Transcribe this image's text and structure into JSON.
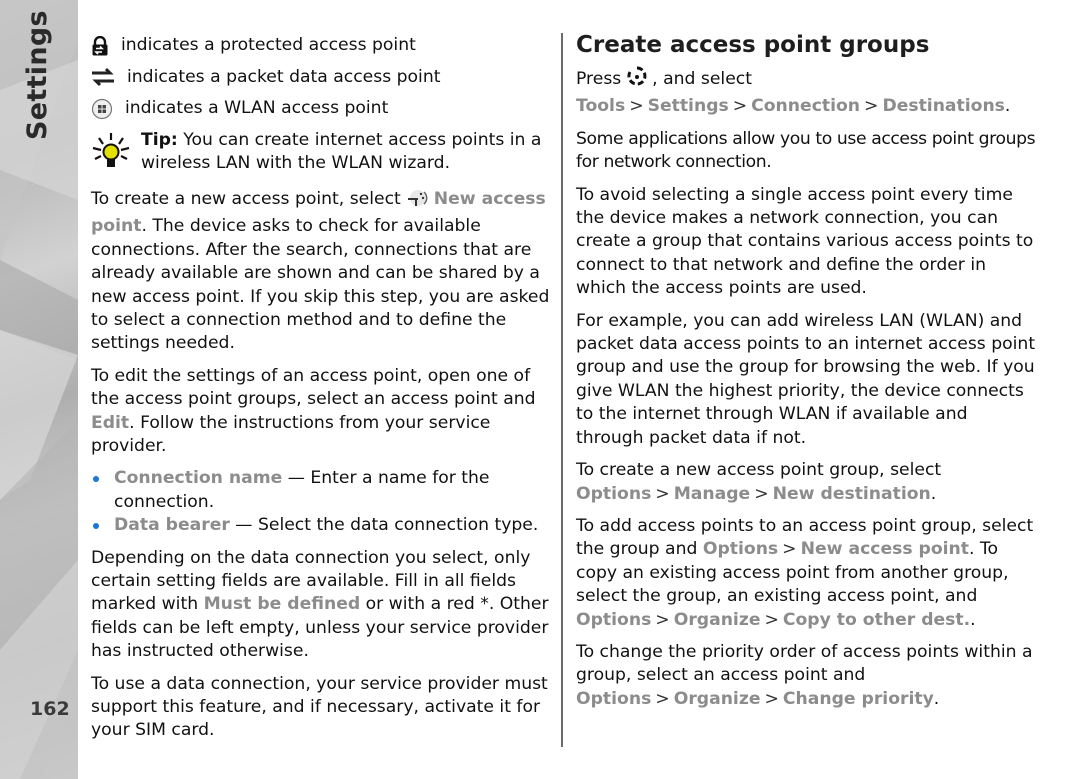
{
  "sidebar": {
    "section_title": "Settings",
    "page_number": "162"
  },
  "left_column": {
    "legend": [
      {
        "icon": "lock-icon",
        "text": "indicates a protected access point"
      },
      {
        "icon": "packet-data-arrows-icon",
        "text": "indicates a packet data access point"
      },
      {
        "icon": "wlan-icon",
        "text": "indicates a WLAN access point"
      }
    ],
    "tip": {
      "icon": "lightbulb-tip-icon",
      "label": "Tip:",
      "text": " You can create internet access points in a wireless LAN with the WLAN wizard."
    },
    "p1": {
      "before": "To create a new access point, select ",
      "icon": "new-access-point-icon",
      "ui": "New access point",
      "after": ". The device asks to check for available connections. After the search, connections that are already available are shown and can be shared by a new access point. If you skip this step, you are asked to select a connection method and to define the settings needed."
    },
    "p2": {
      "before": "To edit the settings of an access point, open one of the access point groups, select an access point and ",
      "ui": "Edit",
      "after": ". Follow the instructions from your service provider."
    },
    "bullets": [
      {
        "term": "Connection name",
        "desc": " — Enter a name for the connection."
      },
      {
        "term": "Data bearer",
        "desc": " — Select the data connection type."
      }
    ],
    "p3": {
      "before": "Depending on the data connection you select, only certain setting fields are available. Fill in all fields marked with ",
      "ui": "Must be defined",
      "after": " or with a red *. Other fields can be left empty, unless your service provider has instructed otherwise."
    },
    "p4": "To use a data connection, your service provider must support this feature, and if necessary, activate it for your SIM card."
  },
  "right_column": {
    "heading": "Create access point groups",
    "press": {
      "before": "Press ",
      "icon": "menu-key-icon",
      "middle": " , and select ",
      "path": [
        "Tools",
        "Settings",
        "Connection",
        "Destinations"
      ],
      "sep": ">",
      "end": "."
    },
    "p1": "Some applications allow you to use access point groups for network connection.",
    "p2": "To avoid selecting a single access point every time the device makes a network connection, you can create a group that contains various access points to connect to that network and define the order in which the access points are used.",
    "p3": "For example, you can add wireless LAN (WLAN) and packet data access points to an internet access point group and use the group for browsing the web. If you give WLAN the highest priority, the device connects to the internet through WLAN if available and through packet data if not.",
    "p4": {
      "before": "To create a new access point group, select ",
      "path": [
        "Options",
        "Manage",
        "New destination"
      ],
      "end": "."
    },
    "p5": {
      "before": "To add access points to an access point group, select the group and ",
      "path1": [
        "Options",
        "New access point"
      ],
      "middle": ". To copy an existing access point from another group, select the group, an existing access point, and ",
      "path2": [
        "Options",
        "Organize",
        "Copy to other dest."
      ],
      "end": "."
    },
    "p6": {
      "before": "To change the priority order of access points within a group, select an access point and ",
      "path": [
        "Options",
        "Organize",
        "Change priority"
      ],
      "end": "."
    }
  }
}
